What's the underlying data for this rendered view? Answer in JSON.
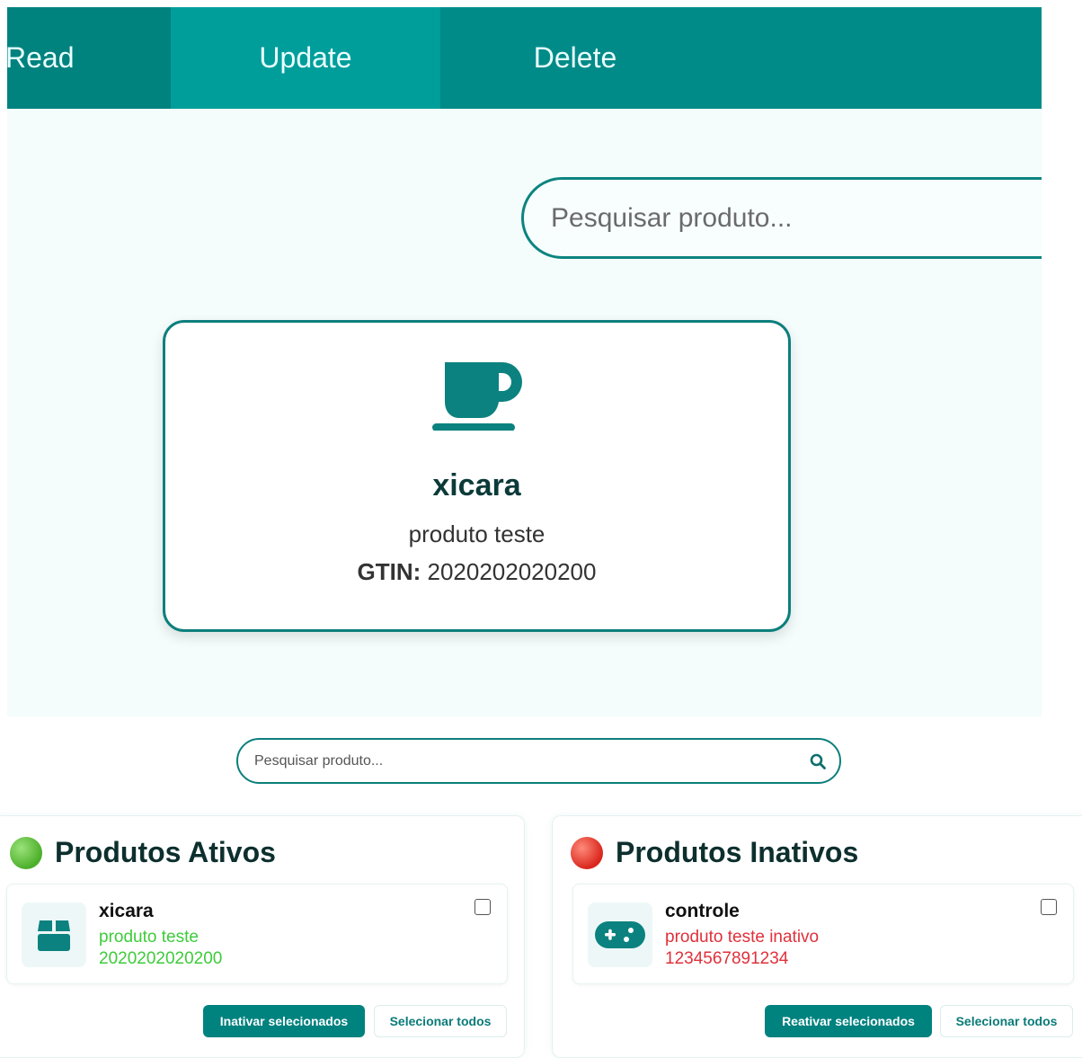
{
  "nav": {
    "tabs": [
      {
        "label": "Read"
      },
      {
        "label": "Update",
        "active": true
      },
      {
        "label": "Delete"
      }
    ]
  },
  "top_search": {
    "placeholder": "Pesquisar produto..."
  },
  "product_card": {
    "icon": "cup-icon",
    "name": "xicara",
    "description": "produto teste",
    "gtin_label": "GTIN:",
    "gtin_value": "2020202020200"
  },
  "list_search": {
    "placeholder": "Pesquisar produto...",
    "icon": "search-icon"
  },
  "active_panel": {
    "status_icon": "🟢",
    "title": "Produtos Ativos",
    "items": [
      {
        "icon": "box-icon",
        "name": "xicara",
        "description": "produto teste",
        "gtin": "2020202020200"
      }
    ],
    "primary_button": "Inativar selecionados",
    "secondary_button": "Selecionar todos"
  },
  "inactive_panel": {
    "status_icon": "🔴",
    "title": "Produtos Inativos",
    "items": [
      {
        "icon": "gamepad-icon",
        "name": "controle",
        "description": "produto teste inativo",
        "gtin": "1234567891234"
      }
    ],
    "primary_button": "Reativar selecionados",
    "secondary_button": "Selecionar todos"
  },
  "colors": {
    "brand": "#008b88",
    "active_text": "#3ecb3b",
    "inactive_text": "#e0303b"
  }
}
